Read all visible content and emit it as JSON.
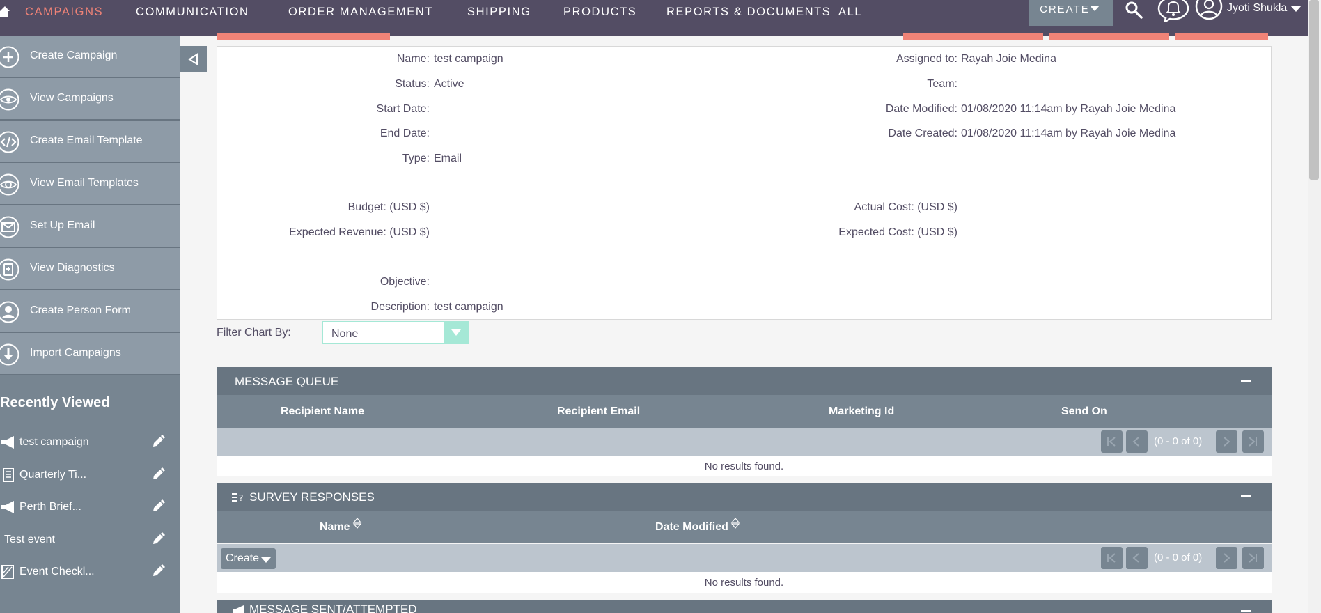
{
  "nav": {
    "items": [
      "CAMPAIGNS",
      "COMMUNICATION",
      "ORDER MANAGEMENT",
      "SHIPPING",
      "PRODUCTS",
      "REPORTS & DOCUMENTS",
      "ALL"
    ],
    "create_label": "CREATE",
    "user_name": "Jyoti Shukla",
    "active_color": "#f08377",
    "bar_color": "#534d64"
  },
  "sidebar": {
    "actions": [
      {
        "label": "Create Campaign",
        "icon": "plus-circle-icon"
      },
      {
        "label": "View Campaigns",
        "icon": "eye-icon"
      },
      {
        "label": "Create Email Template",
        "icon": "code-icon"
      },
      {
        "label": "View Email Templates",
        "icon": "eye-circle-icon"
      },
      {
        "label": "Set Up Email",
        "icon": "envelope-icon"
      },
      {
        "label": "View Diagnostics",
        "icon": "clipboard-icon"
      },
      {
        "label": "Create Person Form",
        "icon": "person-icon"
      },
      {
        "label": "Import Campaigns",
        "icon": "download-icon"
      }
    ],
    "recent_title": "Recently Viewed",
    "recent": [
      {
        "label": "test campaign",
        "icon": "megaphone-icon"
      },
      {
        "label": "Quarterly Ti...",
        "icon": "document-icon"
      },
      {
        "label": "Perth Brief...",
        "icon": "megaphone-icon"
      },
      {
        "label": "Test event",
        "icon": ""
      },
      {
        "label": "Event Checkl...",
        "icon": "checklist-icon"
      }
    ]
  },
  "detail": {
    "left": [
      {
        "label": "Name:",
        "value": "test campaign"
      },
      {
        "label": "Status:",
        "value": "Active"
      },
      {
        "label": "Start Date:",
        "value": ""
      },
      {
        "label": "End Date:",
        "value": ""
      },
      {
        "label": "Type:",
        "value": "Email"
      },
      {
        "label": "Budget: (USD $)",
        "value": ""
      },
      {
        "label": "Expected Revenue: (USD $)",
        "value": ""
      },
      {
        "label": "Objective:",
        "value": ""
      },
      {
        "label": "Description:",
        "value": "test campaign"
      }
    ],
    "right": [
      {
        "label": "Assigned to:",
        "value": "Rayah Joie Medina"
      },
      {
        "label": "Team:",
        "value": ""
      },
      {
        "label": "Date Modified:",
        "value": "01/08/2020 11:14am by Rayah Joie Medina"
      },
      {
        "label": "Date Created:",
        "value": "01/08/2020 11:14am by Rayah Joie Medina"
      },
      {
        "label": "Actual Cost: (USD $)",
        "value": ""
      },
      {
        "label": "Expected Cost: (USD $)",
        "value": ""
      }
    ]
  },
  "filter": {
    "label": "Filter Chart By:",
    "value": "None",
    "accent": "#a5e8d6"
  },
  "message_queue": {
    "title": "MESSAGE QUEUE",
    "columns": [
      "Recipient Name",
      "Recipient Email",
      "Marketing Id",
      "Send On"
    ],
    "count": "(0 - 0 of 0)",
    "empty": "No results found."
  },
  "survey_responses": {
    "title": "SURVEY RESPONSES",
    "columns": [
      "Name",
      "Date Modified"
    ],
    "create_label": "Create",
    "count": "(0 - 0 of 0)",
    "empty": "No results found."
  },
  "message_sent": {
    "title": "MESSAGE SENT/ATTEMPTED"
  }
}
